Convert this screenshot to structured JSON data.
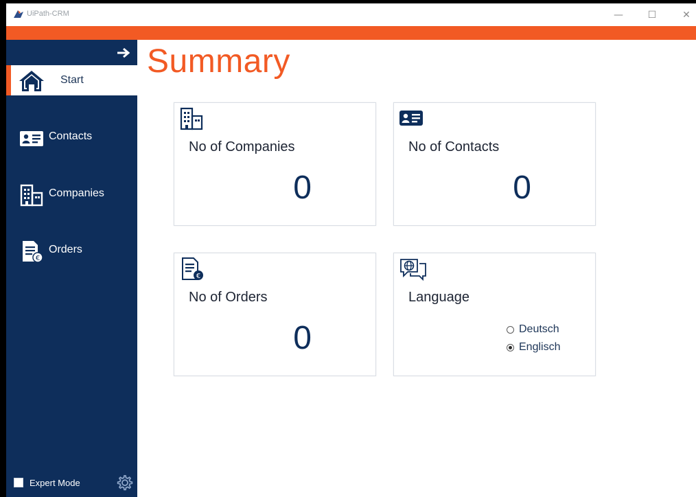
{
  "window": {
    "title": "UiPath-CRM",
    "controls": {
      "minimize": "—",
      "maximize": "☐",
      "close": "✕"
    }
  },
  "colors": {
    "accent": "#f25a24",
    "sidebar": "#0e2e5b",
    "text_dark": "#1d2433"
  },
  "sidebar": {
    "toggle_icon": "arrow-right-icon",
    "items": [
      {
        "label": "Start",
        "icon": "home-icon",
        "active": true
      },
      {
        "label": "Contacts",
        "icon": "contact-card-icon",
        "active": false
      },
      {
        "label": "Companies",
        "icon": "building-icon",
        "active": false
      },
      {
        "label": "Orders",
        "icon": "order-document-icon",
        "active": false
      }
    ],
    "expert_mode": {
      "label": "Expert Mode",
      "checked": false
    },
    "settings_icon": "gear-icon"
  },
  "main": {
    "title": "Summary",
    "cards": {
      "companies": {
        "label": "No of Companies",
        "value": "0",
        "icon": "building-icon"
      },
      "contacts": {
        "label": "No of Contacts",
        "value": "0",
        "icon": "contact-card-icon"
      },
      "orders": {
        "label": "No of Orders",
        "value": "0",
        "icon": "order-document-icon"
      },
      "language": {
        "label": "Language",
        "icon": "globe-chat-icon",
        "options": [
          {
            "label": "Deutsch",
            "selected": false
          },
          {
            "label": "Englisch",
            "selected": true
          }
        ]
      }
    }
  }
}
